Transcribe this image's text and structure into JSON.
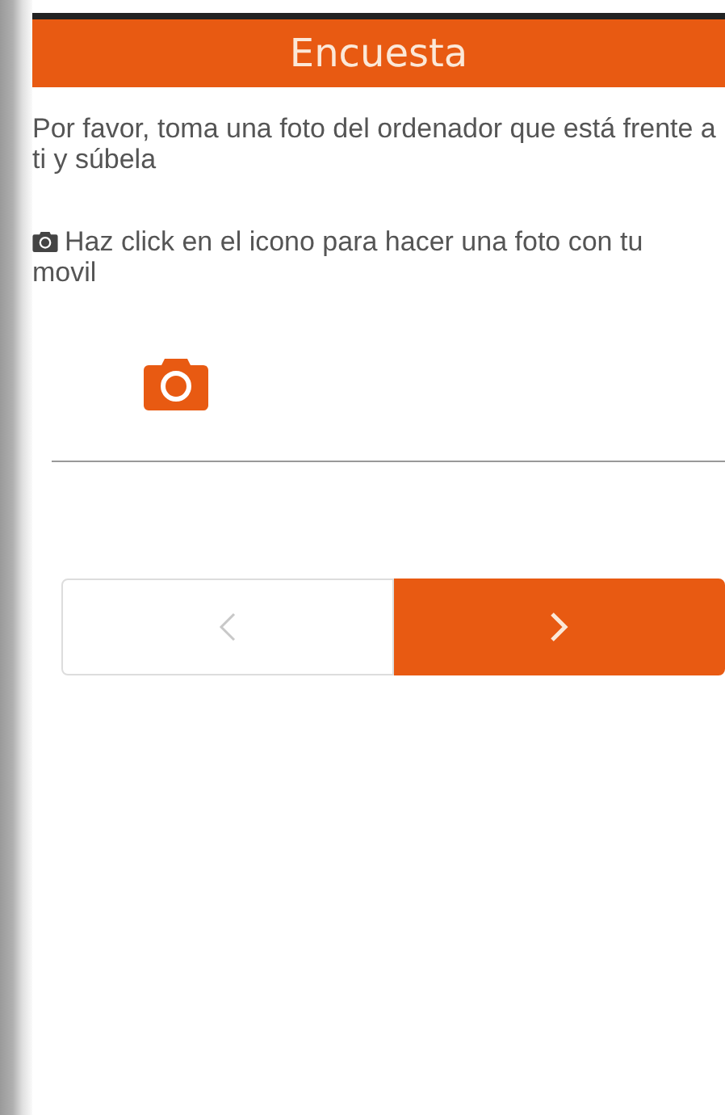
{
  "header": {
    "title": "Encuesta"
  },
  "question": {
    "text": "Por favor, toma una foto del ordenador que está frente a ti y súbela",
    "hint": "Haz click en el icono para hacer una foto con tu movil"
  },
  "nav": [
    {
      "kind": "prev",
      "disabled": true
    },
    {
      "kind": "next",
      "disabled": false
    }
  ]
}
